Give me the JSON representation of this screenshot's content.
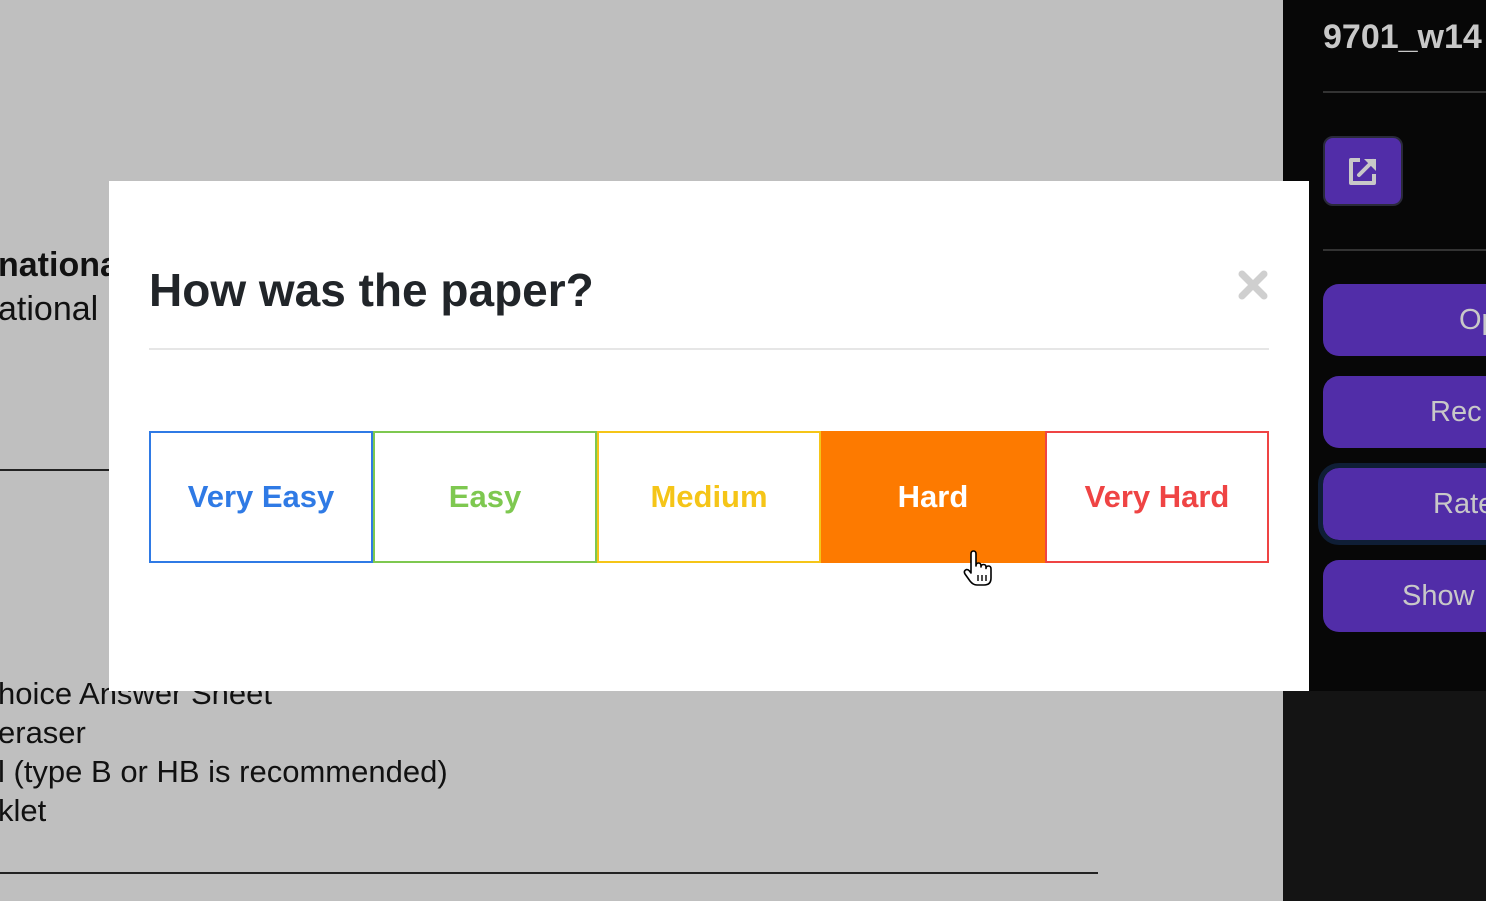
{
  "document": {
    "heading_fragment": "nationa",
    "subheading_fragment": "ational",
    "list_items": [
      "hoice Answer Sheet",
      " eraser",
      "l (type B or HB is recommended)",
      "klet"
    ]
  },
  "sidebar": {
    "title": "9701_w14",
    "open_external_icon": "external-link-icon",
    "buttons": [
      {
        "label": "Op"
      },
      {
        "label": "Rec"
      },
      {
        "label": "Rate"
      },
      {
        "label": "Show"
      }
    ],
    "accent_color": "#512da8"
  },
  "modal": {
    "title": "How was the paper?",
    "close_icon": "close-icon",
    "options": [
      {
        "label": "Very Easy",
        "color": "#2f7ae5",
        "selected": false
      },
      {
        "label": "Easy",
        "color": "#7ec850",
        "selected": false
      },
      {
        "label": "Medium",
        "color": "#f5c518",
        "selected": false
      },
      {
        "label": "Hard",
        "color": "#fd7a00",
        "selected": true
      },
      {
        "label": "Very Hard",
        "color": "#ef4444",
        "selected": false
      }
    ]
  }
}
